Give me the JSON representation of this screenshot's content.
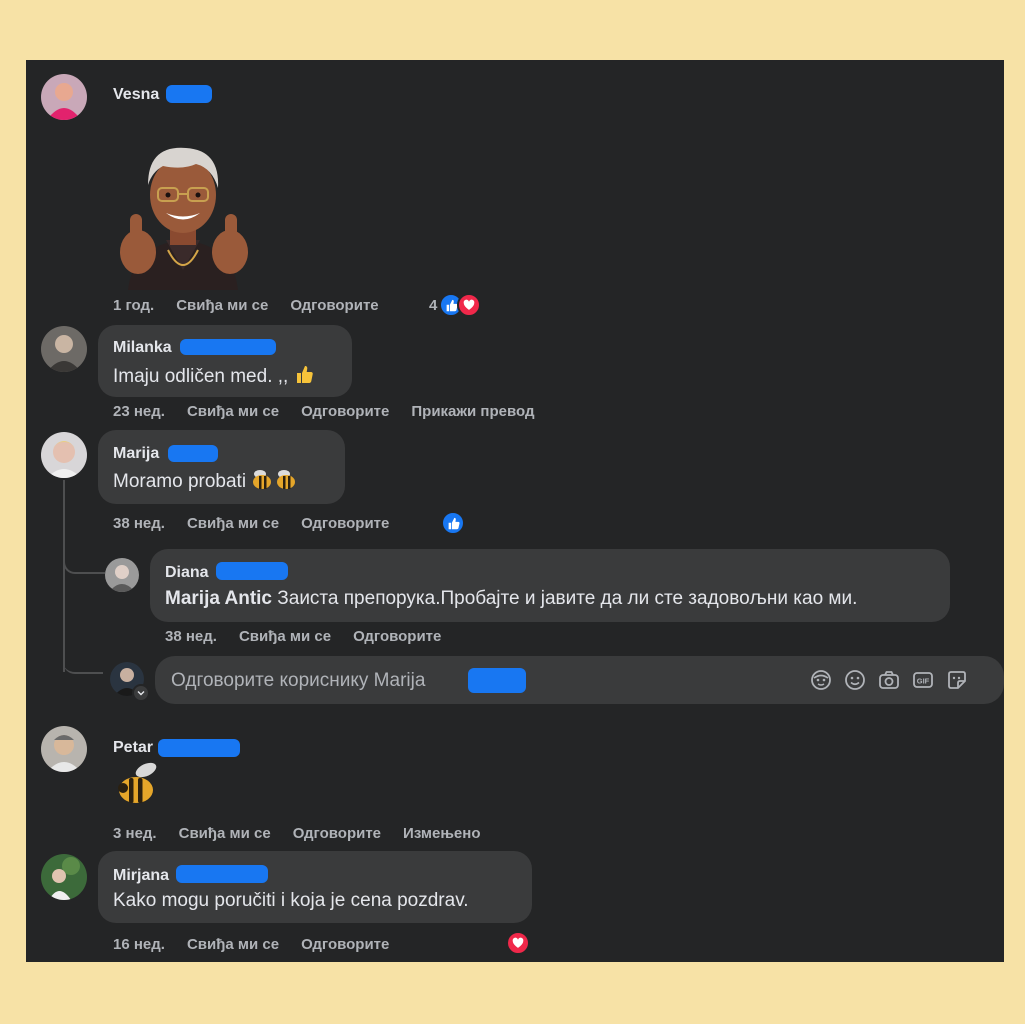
{
  "comments": [
    {
      "id": "vesna",
      "name": "Vesna",
      "text": "",
      "meta": {
        "time": "1 год.",
        "like": "Свиђа ми се",
        "reply": "Одговорите"
      },
      "reactions": {
        "count": "4",
        "types": [
          "like",
          "love"
        ]
      }
    },
    {
      "id": "milanka",
      "name": "Milanka",
      "text": "Imaju odličen med. ,,",
      "emoji": "thumbs-up",
      "meta": {
        "time": "23 нед.",
        "like": "Свиђа ми се",
        "reply": "Одговорите",
        "extra": "Прикажи превод"
      }
    },
    {
      "id": "marija",
      "name": "Marija",
      "text": "Moramo probati",
      "emoji": "bee-bee",
      "meta": {
        "time": "38 нед.",
        "like": "Свиђа ми се",
        "reply": "Одговорите"
      },
      "reactions": {
        "types": [
          "like"
        ]
      }
    },
    {
      "id": "diana",
      "name": "Diana",
      "mention": "Marija Antic",
      "text": " Заиста препорука.Пробајте и јавите да ли сте задовољни као ми.",
      "meta": {
        "time": "38 нед.",
        "like": "Свиђа ми се",
        "reply": "Одговорите"
      }
    },
    {
      "id": "petar",
      "name": "Petar",
      "emoji": "bee",
      "meta": {
        "time": "3 нед.",
        "like": "Свиђа ми се",
        "reply": "Одговорите",
        "extra": "Измењено"
      }
    },
    {
      "id": "mirjana",
      "name": "Mirjana",
      "text": "Kako mogu poručiti i koja je cena pozdrav.",
      "meta": {
        "time": "16 нед.",
        "like": "Свиђа ми се",
        "reply": "Одговорите"
      },
      "reactions": {
        "types": [
          "love"
        ]
      }
    }
  ],
  "reply_box": {
    "placeholder": "Одговорите кориснику Marija",
    "tools": [
      "avatar-sticker-icon",
      "emoji-icon",
      "camera-icon",
      "gif-icon",
      "sticker-icon"
    ]
  },
  "colors": {
    "panel": "#242526",
    "bubble": "#3a3b3c",
    "text": "#e4e6eb",
    "muted": "#b0b3b8",
    "like": "#1877f2",
    "love": "#f0284a",
    "page": "#f7e2a6"
  }
}
